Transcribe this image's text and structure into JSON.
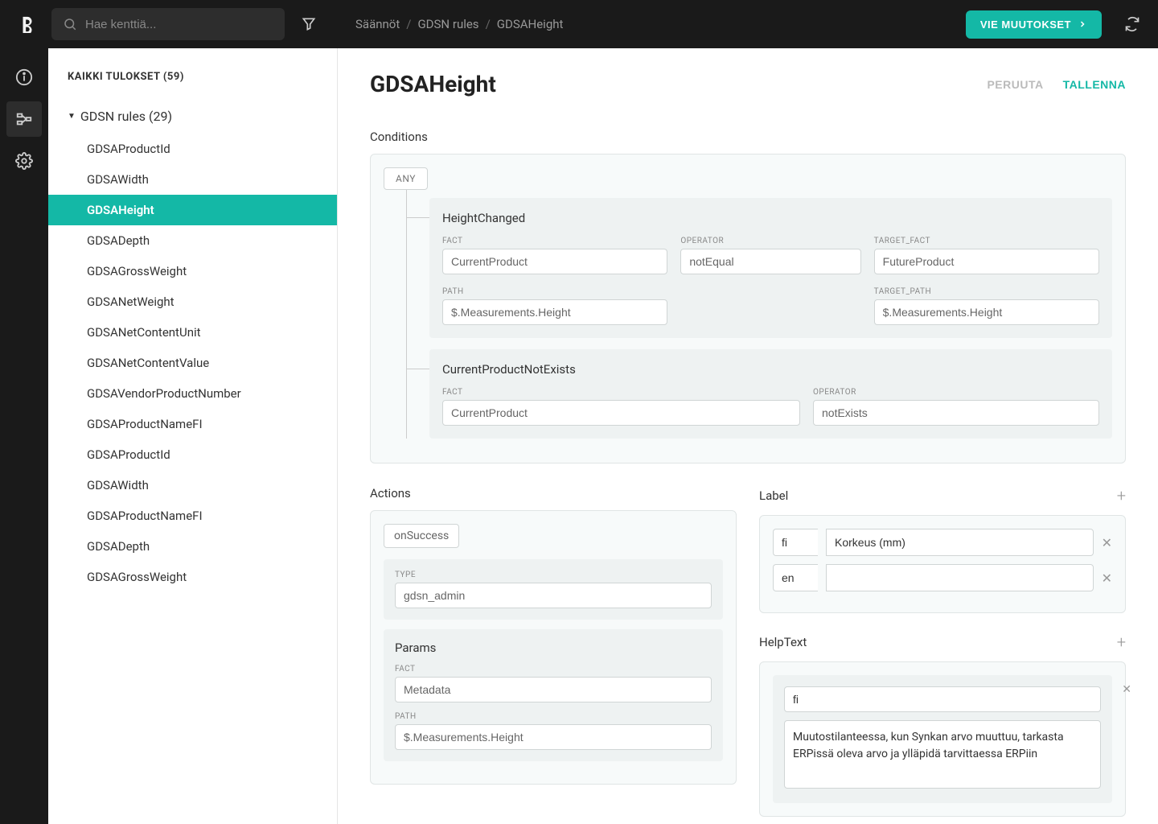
{
  "search": {
    "placeholder": "Hae kenttiä..."
  },
  "breadcrumb": [
    "Säännöt",
    "GDSN rules",
    "GDSAHeight"
  ],
  "publish_btn": "VIE MUUTOKSET",
  "sidebar": {
    "header": "KAIKKI TULOKSET (59)",
    "group_title": "GDSN rules (29)",
    "items": [
      "GDSAProductId",
      "GDSAWidth",
      "GDSAHeight",
      "GDSADepth",
      "GDSAGrossWeight",
      "GDSANetWeight",
      "GDSANetContentUnit",
      "GDSANetContentValue",
      "GDSAVendorProductNumber",
      "GDSAProductNameFI",
      "GDSAProductId",
      "GDSAWidth",
      "GDSAProductNameFI",
      "GDSADepth",
      "GDSAGrossWeight"
    ],
    "active_index": 2
  },
  "main": {
    "title": "GDSAHeight",
    "cancel": "PERUUTA",
    "save": "TALLENNA"
  },
  "sections": {
    "conditions": "Conditions",
    "actions": "Actions",
    "label": "Label",
    "helptext": "HelpText"
  },
  "conditions": {
    "mode": "ANY",
    "items": [
      {
        "name": "HeightChanged",
        "fields": {
          "fact_lbl": "FACT",
          "fact": "CurrentProduct",
          "operator_lbl": "OPERATOR",
          "operator": "notEqual",
          "target_fact_lbl": "TARGET_FACT",
          "target_fact": "FutureProduct",
          "path_lbl": "PATH",
          "path": "$.Measurements.Height",
          "target_path_lbl": "TARGET_PATH",
          "target_path": "$.Measurements.Height"
        }
      },
      {
        "name": "CurrentProductNotExists",
        "fields": {
          "fact_lbl": "FACT",
          "fact": "CurrentProduct",
          "operator_lbl": "OPERATOR",
          "operator": "notExists"
        }
      }
    ]
  },
  "actions": {
    "trigger": "onSuccess",
    "type_lbl": "TYPE",
    "type": "gdsn_admin",
    "params_title": "Params",
    "fact_lbl": "FACT",
    "fact": "Metadata",
    "path_lbl": "PATH",
    "path": "$.Measurements.Height"
  },
  "labels": [
    {
      "lang": "fi",
      "value": "Korkeus (mm)"
    },
    {
      "lang": "en",
      "value": ""
    }
  ],
  "helptext": {
    "lang": "fi",
    "text": "Muutostilanteessa, kun Synkan arvo muuttuu, tarkasta ERPissä oleva arvo ja ylläpidä tarvittaessa ERPiin"
  }
}
